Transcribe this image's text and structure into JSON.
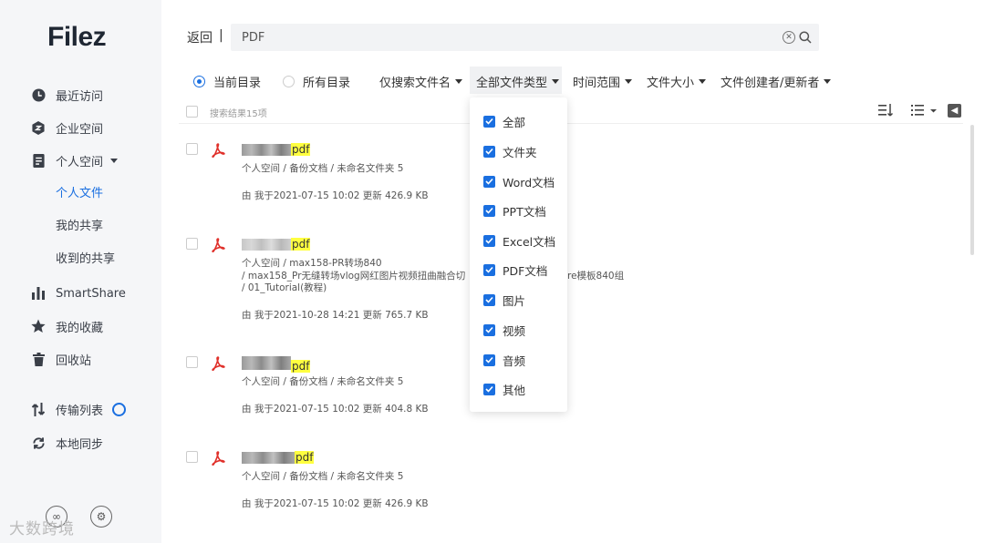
{
  "app": {
    "logo": "Filez"
  },
  "sidebar": {
    "items": [
      {
        "label": "最近访问",
        "icon": "clock-icon"
      },
      {
        "label": "企业空间",
        "icon": "enterprise-icon"
      },
      {
        "label": "个人空间",
        "icon": "personal-space-icon"
      },
      {
        "label": "SmartShare",
        "icon": "bar-chart-icon"
      },
      {
        "label": "我的收藏",
        "icon": "star-icon"
      },
      {
        "label": "回收站",
        "icon": "trash-icon"
      },
      {
        "label": "传输列表",
        "icon": "transfer-icon"
      },
      {
        "label": "本地同步",
        "icon": "sync-icon"
      }
    ],
    "sub_items": [
      {
        "label": "个人文件",
        "active": true
      },
      {
        "label": "我的共享",
        "active": false
      },
      {
        "label": "收到的共享",
        "active": false
      }
    ],
    "watermark": "大数跨境"
  },
  "topbar": {
    "back_label": "返回",
    "separator": "|",
    "search_value": "PDF"
  },
  "filters": {
    "current_dir": "当前目录",
    "all_dirs": "所有目录",
    "name_only": "仅搜索文件名",
    "file_type": "全部文件类型",
    "time_range": "时间范围",
    "file_size": "文件大小",
    "creator": "文件创建者/更新者"
  },
  "list": {
    "result_count": "搜索结果15项",
    "files": [
      {
        "name_suffix": "pdf",
        "path": [
          "个人空间 / 备份文档 / 未命名文件夹 5"
        ],
        "meta": "由 我于2021-07-15 10:02 更新 426.9 KB"
      },
      {
        "name_suffix": "pdf",
        "path": [
          "个人空间 / max158-PR转场840",
          " / max158_Pr无缝转场vlog网红图片视频扭曲融合切",
          " / 01_Tutorial(教程)"
        ],
        "path_tail": "re模板840组",
        "meta": "由 我于2021-10-28 14:21 更新 765.7 KB"
      },
      {
        "name_suffix": "pdf",
        "path": [
          "个人空间 / 备份文档 / 未命名文件夹 5"
        ],
        "meta": "由 我于2021-07-15 10:02 更新 404.8 KB"
      },
      {
        "name_suffix": "pdf",
        "path": [
          "个人空间 / 备份文档 / 未命名文件夹 5"
        ],
        "meta": "由 我于2021-07-15 10:02 更新 426.9 KB"
      }
    ]
  },
  "type_dropdown": {
    "options": [
      "全部",
      "文件夹",
      "Word文档",
      "PPT文档",
      "Excel文档",
      "PDF文档",
      "图片",
      "视频",
      "音频",
      "其他"
    ],
    "checked": [
      true,
      true,
      true,
      true,
      true,
      true,
      true,
      true,
      true,
      true
    ]
  },
  "colors": {
    "accent": "#1a6fe0",
    "highlight": "#ffff40",
    "pdf_red": "#e0302a"
  }
}
